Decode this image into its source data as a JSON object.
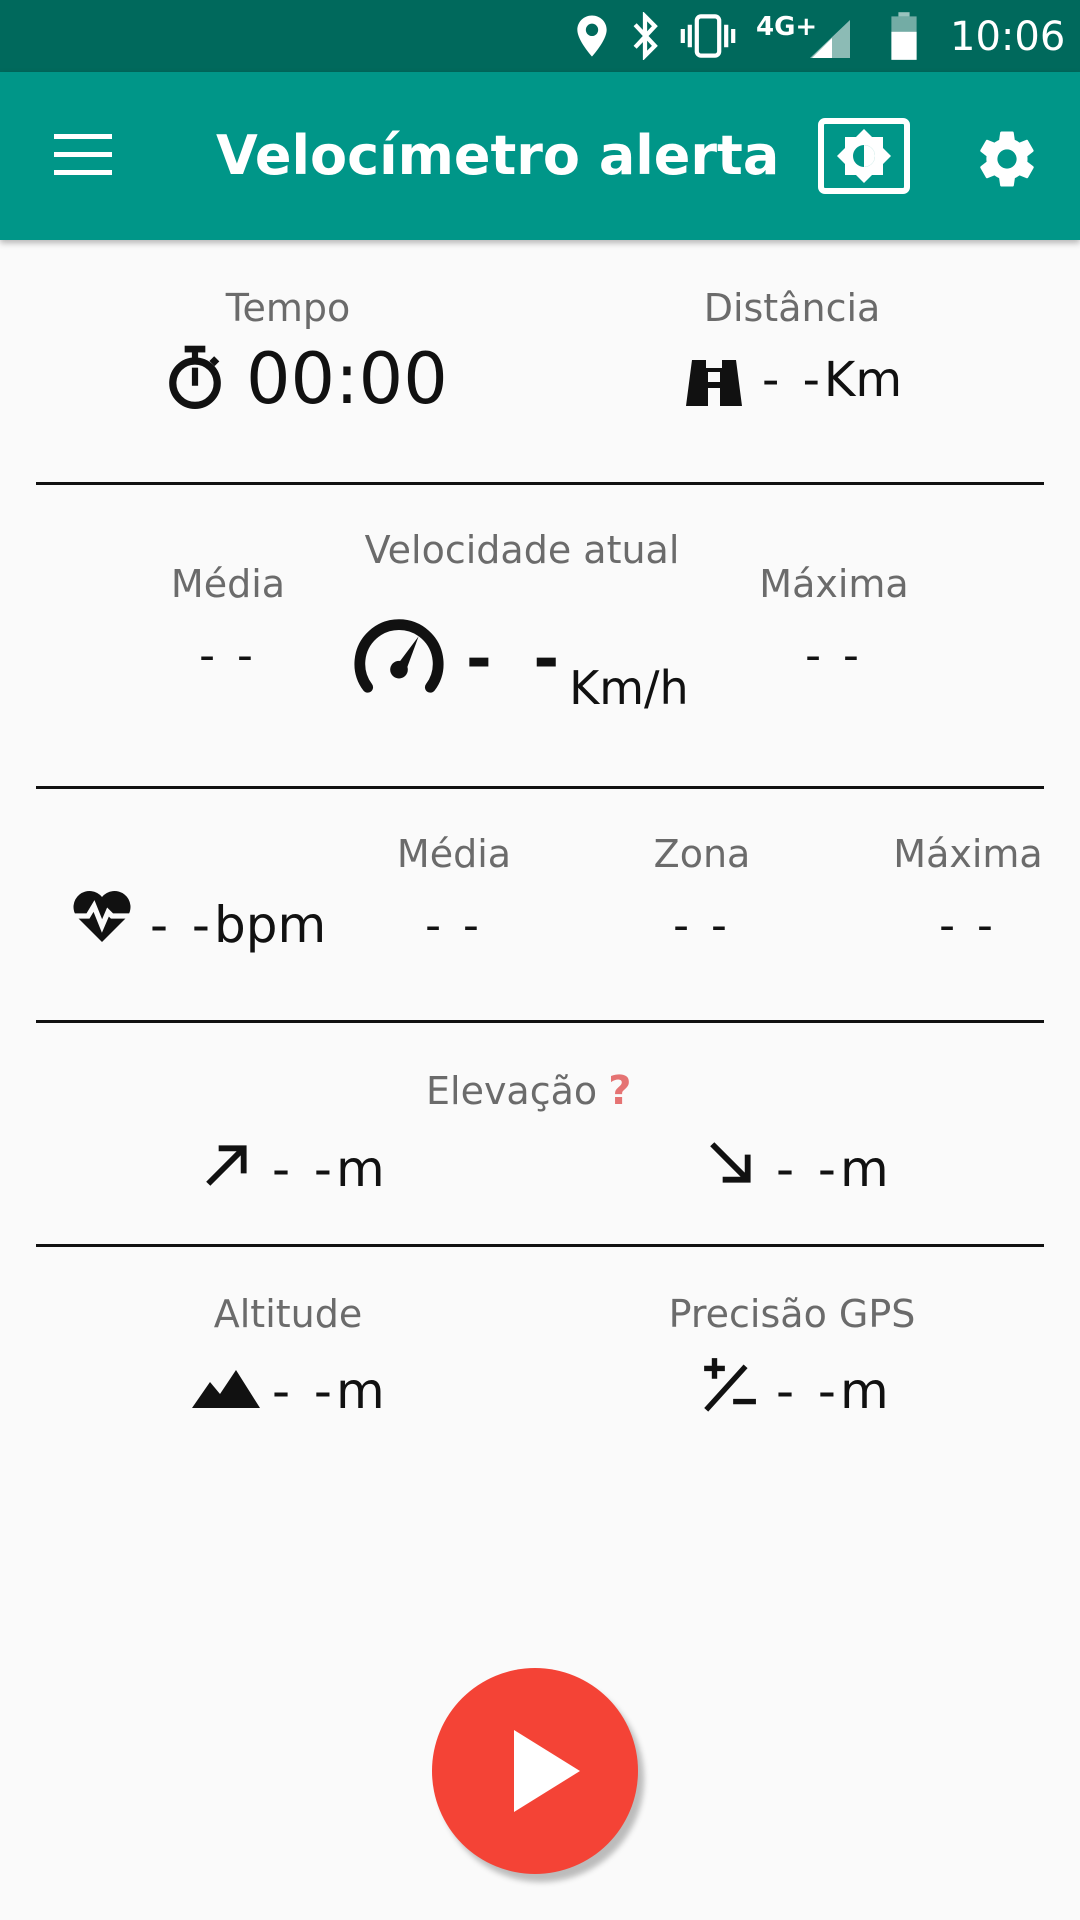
{
  "status_bar": {
    "network": "4G+",
    "time": "10:06"
  },
  "app_bar": {
    "title": "Velocímetro alerta"
  },
  "time_section": {
    "label": "Tempo",
    "value": "00:00"
  },
  "distance_section": {
    "label": "Distância",
    "value": "- -",
    "unit": "Km"
  },
  "speed_section": {
    "avg_label": "Média",
    "avg_value": "- -",
    "current_label": "Velocidade atual",
    "current_value": "- -",
    "unit": "Km/h",
    "max_label": "Máxima",
    "max_value": "- -"
  },
  "heart_section": {
    "value": "- -",
    "unit": "bpm",
    "avg_label": "Média",
    "avg_value": "- -",
    "zone_label": "Zona",
    "zone_value": "- -",
    "max_label": "Máxima",
    "max_value": "- -"
  },
  "elevation_section": {
    "label": "Elevação",
    "help_glyph": "?",
    "up_value": "- -",
    "up_unit": "m",
    "down_value": "- -",
    "down_unit": "m"
  },
  "altitude_section": {
    "label": "Altitude",
    "value": "- -",
    "unit": "m"
  },
  "gps_section": {
    "label": "Precisão GPS",
    "value": "- -",
    "unit": "m"
  },
  "icons": {
    "menu": "menu-icon",
    "brightness": "brightness-icon",
    "settings": "gear-icon",
    "stopwatch": "stopwatch-icon",
    "distance": "binoculars-icon",
    "speed": "speedometer-icon",
    "heart": "heart-pulse-icon",
    "up": "arrow-up-right-icon",
    "down": "arrow-down-right-icon",
    "altitude": "mountain-icon",
    "gps": "plus-minus-icon",
    "play": "play-icon"
  },
  "colors": {
    "status_bar": "#00695c",
    "app_bar": "#009688",
    "fab": "#f44336",
    "help": "#e57373"
  }
}
